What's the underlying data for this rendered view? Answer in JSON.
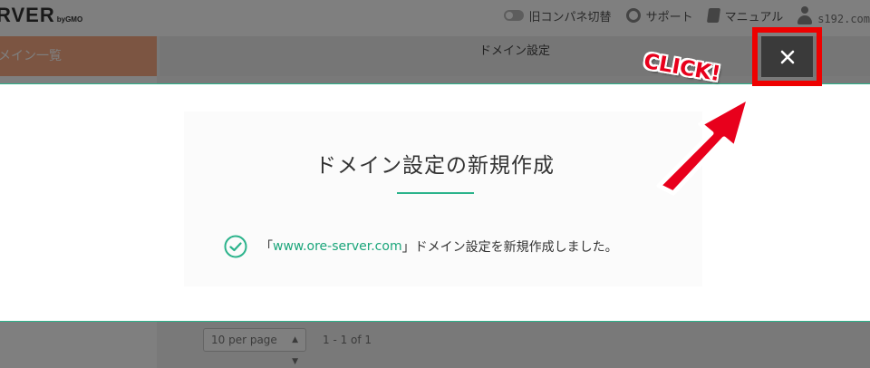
{
  "header": {
    "logo_text": "RVER",
    "logo_sub": "byGMO",
    "legacy_panel_label": "旧コンパネ切替",
    "support_label": "サポート",
    "manual_label": "マニュアル",
    "user_name": "s192.com"
  },
  "sidebar": {
    "active_item_label": "メイン一覧"
  },
  "main": {
    "page_title": "ドメイン設定",
    "pager": {
      "per_page_value": "10 per page",
      "count_text": "1 - 1 of 1"
    }
  },
  "modal": {
    "title": "ドメイン設定の新規作成",
    "message_prefix": "「",
    "domain": "www.ore-server.com",
    "message_suffix": "」ドメイン設定を新規作成しました。",
    "close_icon": "close-x-icon"
  },
  "annotation": {
    "callout_text": "CLICK!",
    "highlight_color": "#ee0000"
  },
  "colors": {
    "accent": "#2bb38b",
    "sidebar_active": "#f9aa85",
    "close_button_bg": "#3a3a3a"
  }
}
